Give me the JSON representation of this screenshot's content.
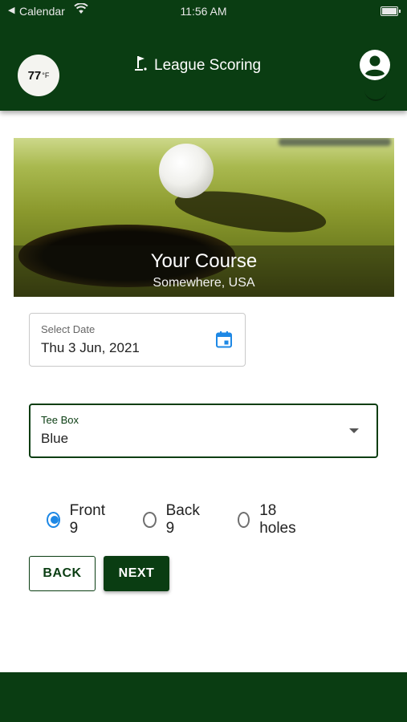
{
  "status_bar": {
    "back_glyph": "◀",
    "app": "Calendar",
    "time": "11:56 AM"
  },
  "header": {
    "weather": {
      "temp": "77",
      "unit": "°F"
    },
    "title": "League Scoring",
    "title_icon": "golf-flag-icon",
    "profile_icon": "account-circle-icon"
  },
  "hero": {
    "course_name": "Your Course",
    "location": "Somewhere, USA"
  },
  "date_field": {
    "label": "Select Date",
    "value": "Thu 3 Jun, 2021",
    "icon": "calendar-icon"
  },
  "tee_box": {
    "label": "Tee Box",
    "value": "Blue"
  },
  "holes": {
    "options": [
      {
        "label": "Front 9",
        "checked": true
      },
      {
        "label": "Back 9",
        "checked": false
      },
      {
        "label": "18 holes",
        "checked": false
      }
    ]
  },
  "buttons": {
    "back": "BACK",
    "next": "NEXT"
  },
  "colors": {
    "brand_green": "#0a3d12",
    "accent_blue": "#1e88e5"
  }
}
